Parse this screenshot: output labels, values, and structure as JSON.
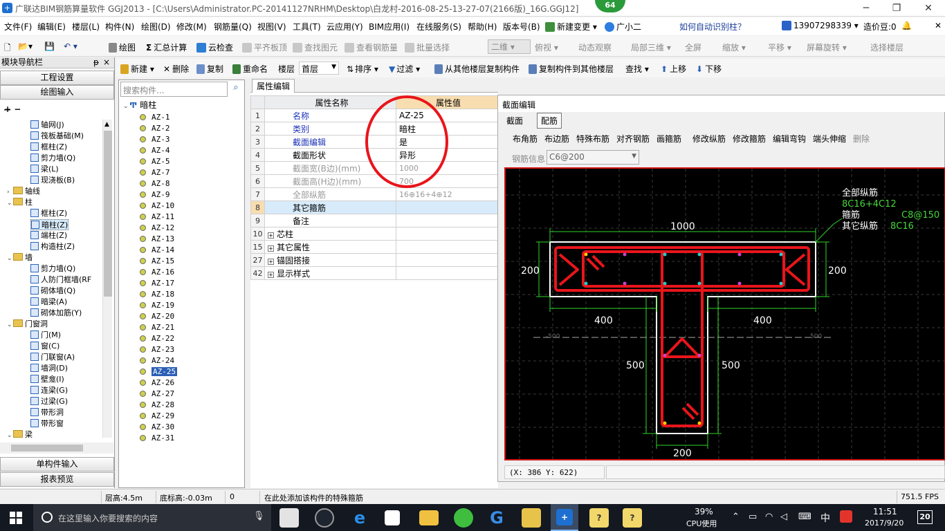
{
  "window": {
    "title": "广联达BIM钢筋算量软件 GGJ2013 - [C:\\Users\\Administrator.PC-20141127NRHM\\Desktop\\白龙村-2016-08-25-13-27-07(2166版)_16G.GGJ12]",
    "badge": "64"
  },
  "menu": [
    "文件(F)",
    "编辑(E)",
    "楼层(L)",
    "构件(N)",
    "绘图(D)",
    "修改(M)",
    "钢筋量(Q)",
    "视图(V)",
    "工具(T)",
    "云应用(Y)",
    "BIM应用(I)",
    "在线服务(S)",
    "帮助(H)",
    "版本号(B)",
    "新建变更",
    "广小二"
  ],
  "menu_right": {
    "help_link": "如何自动识别柱？",
    "phone": "13907298339",
    "price": "造价豆:0"
  },
  "toolbar1": {
    "draw": "绘图",
    "sum": "汇总计算",
    "cloud_check": "云检查",
    "flat_top": "平齐板顶",
    "find_elem": "查找图元",
    "view_rebar": "查看钢筋量",
    "batch_select": "批量选择",
    "view_mode": "二维",
    "top_view": "俯视",
    "dyn_view": "动态观察",
    "local_3d": "局部三维",
    "full_screen": "全屏",
    "zoom": "缩放",
    "pan": "平移",
    "rotate": "屏幕旋转",
    "select_floor": "选择楼层"
  },
  "nav": {
    "title": "模块导航栏",
    "pin": "ᵽ",
    "close": "×",
    "project_settings": "工程设置",
    "draw_input": "绘图输入",
    "single_input": "单构件输入",
    "report": "报表预览",
    "tree": [
      {
        "label": "轴网(J)",
        "level": 2
      },
      {
        "label": "筏板基础(M)",
        "level": 2
      },
      {
        "label": "框柱(Z)",
        "level": 2
      },
      {
        "label": "剪力墙(Q)",
        "level": 2
      },
      {
        "label": "梁(L)",
        "level": 2
      },
      {
        "label": "现浇板(B)",
        "level": 2
      },
      {
        "label": "轴线",
        "level": 1,
        "folder": true,
        "exp": "›"
      },
      {
        "label": "柱",
        "level": 1,
        "folder": true,
        "exp": "⌄"
      },
      {
        "label": "框柱(Z)",
        "level": 2
      },
      {
        "label": "暗柱(Z)",
        "level": 2,
        "selected": true
      },
      {
        "label": "端柱(Z)",
        "level": 2
      },
      {
        "label": "构造柱(Z)",
        "level": 2
      },
      {
        "label": "墙",
        "level": 1,
        "folder": true,
        "exp": "⌄"
      },
      {
        "label": "剪力墙(Q)",
        "level": 2
      },
      {
        "label": "人防门框墙(RF",
        "level": 2
      },
      {
        "label": "砌体墙(Q)",
        "level": 2
      },
      {
        "label": "暗梁(A)",
        "level": 2
      },
      {
        "label": "砌体加筋(Y)",
        "level": 2
      },
      {
        "label": "门窗洞",
        "level": 1,
        "folder": true,
        "exp": "⌄"
      },
      {
        "label": "门(M)",
        "level": 2
      },
      {
        "label": "窗(C)",
        "level": 2
      },
      {
        "label": "门联窗(A)",
        "level": 2
      },
      {
        "label": "墙洞(D)",
        "level": 2
      },
      {
        "label": "壁龛(I)",
        "level": 2
      },
      {
        "label": "连梁(G)",
        "level": 2
      },
      {
        "label": "过梁(G)",
        "level": 2
      },
      {
        "label": "带形洞",
        "level": 2
      },
      {
        "label": "带形窗",
        "level": 2
      },
      {
        "label": "梁",
        "level": 1,
        "folder": true,
        "exp": "⌄"
      }
    ]
  },
  "toolbar2": {
    "new": "新建",
    "delete": "删除",
    "copy": "复制",
    "rename": "重命名",
    "floor_label": "楼层",
    "floor": "首层",
    "sort": "排序",
    "filter": "过滤",
    "copy_from": "从其他楼层复制构件",
    "copy_to": "复制构件到其他楼层",
    "find": "查找",
    "up": "上移",
    "down": "下移"
  },
  "components": {
    "search_placeholder": "搜索构件...",
    "root": "暗柱",
    "items": [
      "AZ-1",
      "AZ-2",
      "AZ-3",
      "AZ-4",
      "AZ-5",
      "AZ-7",
      "AZ-8",
      "AZ-9",
      "AZ-10",
      "AZ-11",
      "AZ-12",
      "AZ-13",
      "AZ-14",
      "AZ-15",
      "AZ-16",
      "AZ-17",
      "AZ-18",
      "AZ-19",
      "AZ-20",
      "AZ-21",
      "AZ-22",
      "AZ-23",
      "AZ-24",
      "AZ-25",
      "AZ-26",
      "AZ-27",
      "AZ-28",
      "AZ-29",
      "AZ-30",
      "AZ-31"
    ],
    "selected": "AZ-25"
  },
  "properties": {
    "tab": "属性编辑",
    "header_name": "属性名称",
    "header_value": "属性值",
    "rows": [
      {
        "num": "1",
        "name": "名称",
        "value": "AZ-25",
        "style": "blue"
      },
      {
        "num": "2",
        "name": "类别",
        "value": "暗柱",
        "style": "blue"
      },
      {
        "num": "3",
        "name": "截面编辑",
        "value": "是",
        "style": "blue"
      },
      {
        "num": "4",
        "name": "截面形状",
        "value": "异形",
        "style": "normal"
      },
      {
        "num": "5",
        "name": "截面宽(B边)(mm)",
        "value": "1000",
        "style": "gray"
      },
      {
        "num": "6",
        "name": "截面高(H边)(mm)",
        "value": "700",
        "style": "gray"
      },
      {
        "num": "7",
        "name": "全部纵筋",
        "value": "16⊕16+4⊕12",
        "style": "gray"
      },
      {
        "num": "8",
        "name": "其它箍筋",
        "value": "",
        "style": "selected"
      },
      {
        "num": "9",
        "name": "备注",
        "value": "",
        "style": "normal"
      },
      {
        "num": "10",
        "name": "芯柱",
        "value": "",
        "style": "group"
      },
      {
        "num": "15",
        "name": "其它属性",
        "value": "",
        "style": "group"
      },
      {
        "num": "27",
        "name": "锚固搭接",
        "value": "",
        "style": "group"
      },
      {
        "num": "42",
        "name": "显示样式",
        "value": "",
        "style": "group"
      }
    ]
  },
  "section_editor": {
    "title": "截面编辑",
    "tabs": [
      "截面",
      "配筋"
    ],
    "tools": [
      "布角筋",
      "布边筋",
      "特殊布筋",
      "对齐钢筋",
      "画箍筋",
      "修改纵筋",
      "修改箍筋",
      "编辑弯钩",
      "端头伸缩",
      "删除"
    ],
    "rebar_info_label": "钢筋信息",
    "rebar_info_value": "C6@200",
    "legend": [
      {
        "label": "全部纵筋",
        "value": "8C16+4C12"
      },
      {
        "label": "箍筋",
        "value": "C8@150"
      },
      {
        "label": "其它纵筋",
        "value": "8C16"
      }
    ],
    "dims": {
      "top": "1000",
      "left": "200",
      "right": "200",
      "flange_left": "400",
      "flange_right": "400",
      "web_left": "500",
      "web_right": "500",
      "bottom": "200",
      "axis_left": "-500",
      "axis_right": "500"
    },
    "coord": "(X: 386 Y: 622)"
  },
  "status": {
    "floor_height": "层高:4.5m",
    "base_height": "底标高:-0.03m",
    "zero": "0",
    "hint": "在此处添加该构件的特殊箍筋",
    "fps": "751.5 FPS"
  },
  "taskbar": {
    "search_placeholder": "在这里输入你要搜索的内容",
    "cpu": "39%",
    "cpu_label": "CPU使用",
    "ime": "中",
    "time": "11:51",
    "date": "2017/9/20",
    "notif": "20"
  },
  "colors": {
    "rebar": "#e8151b",
    "text_green": "#46d63a",
    "canvas": "#000000",
    "highlight": "#d7ebfb",
    "selection_circle": "#e8151b"
  }
}
